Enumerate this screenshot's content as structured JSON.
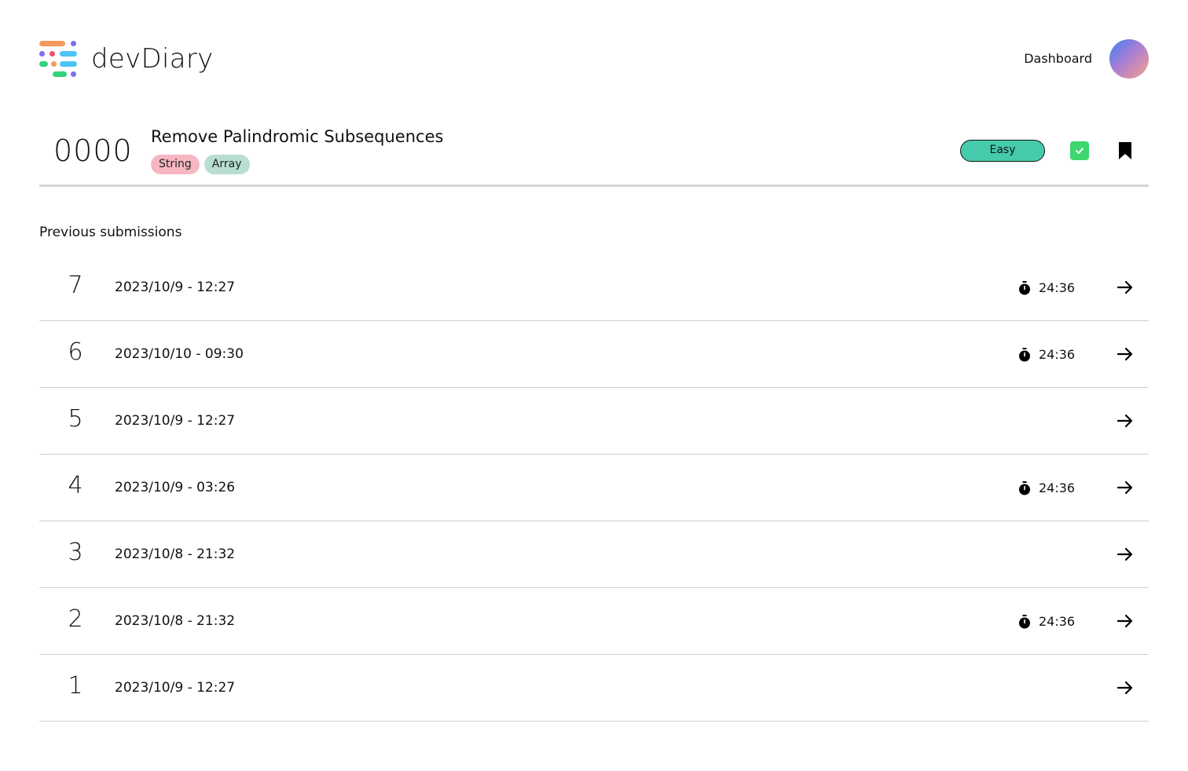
{
  "app": {
    "brand": "devDiary",
    "nav_dashboard": "Dashboard"
  },
  "problem": {
    "id": "0000",
    "title": "Remove Palindromic Subsequences",
    "tags": [
      "String",
      "Array"
    ],
    "difficulty": "Easy",
    "solved": true,
    "bookmarked": true
  },
  "submissions": {
    "heading": "Previous submissions",
    "rows": [
      {
        "number": "7",
        "datetime": "2023/10/9 - 12:27",
        "time": "24:36"
      },
      {
        "number": "6",
        "datetime": "2023/10/10 - 09:30",
        "time": "24:36"
      },
      {
        "number": "5",
        "datetime": "2023/10/9 - 12:27",
        "time": ""
      },
      {
        "number": "4",
        "datetime": "2023/10/9 - 03:26",
        "time": "24:36"
      },
      {
        "number": "3",
        "datetime": "2023/10/8 - 21:32",
        "time": ""
      },
      {
        "number": "2",
        "datetime": "2023/10/8 - 21:32",
        "time": "24:36"
      },
      {
        "number": "1",
        "datetime": "2023/10/9 - 12:27",
        "time": ""
      }
    ]
  },
  "colors": {
    "easy": "#45cbac",
    "tag_string": "#f7b6c2",
    "tag_array": "#b7ded0",
    "solved": "#3ed66e"
  },
  "icons": {
    "logo": "devdiary-logo-icon",
    "solved": "check-icon",
    "bookmark": "bookmark-icon",
    "timer": "stopwatch-icon",
    "open": "arrow-right-icon"
  }
}
